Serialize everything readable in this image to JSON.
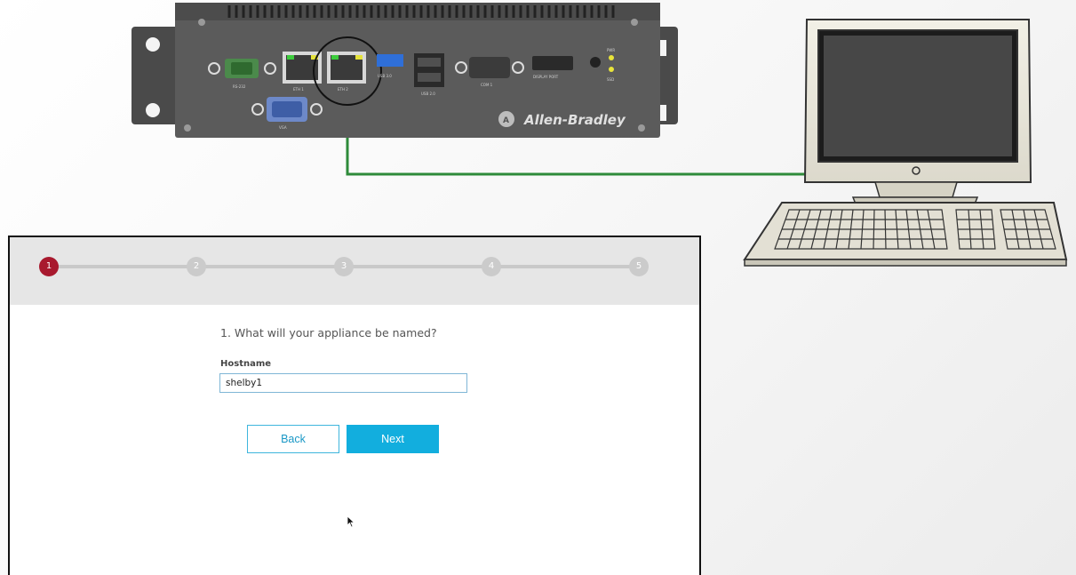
{
  "device": {
    "brand": "Allen-Bradley",
    "port_labels": [
      "RS-232",
      "ETH 1",
      "ETH 2",
      "USB 3.0",
      "USB 2.0",
      "COM 1",
      "DISPLAY PORT",
      "VGA",
      "PWR",
      "SSD"
    ]
  },
  "wizard": {
    "steps": [
      "1",
      "2",
      "3",
      "4",
      "5"
    ],
    "active_step": 1,
    "question": "1. What will your appliance be named?",
    "hostname_label": "Hostname",
    "hostname_value": "shelby1",
    "back_label": "Back",
    "next_label": "Next"
  },
  "colors": {
    "active_step": "#a8192e",
    "inactive_step": "#cbcbcb",
    "accent": "#12aede",
    "cable": "#2e8b3a"
  }
}
